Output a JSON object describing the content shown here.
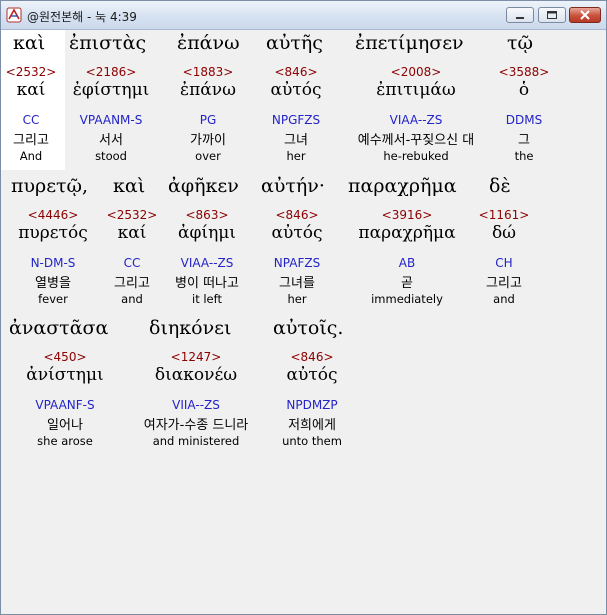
{
  "window": {
    "title": "@원전본해 - 눅 4:39",
    "icons": {
      "app": "app-logo-icon",
      "minimize": "minimize-icon",
      "maximize": "maximize-icon",
      "close": "close-icon"
    }
  },
  "words": [
    {
      "greek": "καὶ",
      "strong": "<2532>",
      "lemma": "καί",
      "parse": "CC",
      "korean": "그리고",
      "english": "And"
    },
    {
      "greek": "ἐπιστὰς",
      "strong": "<2186>",
      "lemma": "ἐφίστημι",
      "parse": "VPAANM-S",
      "korean": "서서",
      "english": "stood"
    },
    {
      "greek": "ἐπάνω",
      "strong": "<1883>",
      "lemma": "ἐπάνω",
      "parse": "PG",
      "korean": "가까이",
      "english": "over"
    },
    {
      "greek": "αὐτῆς",
      "strong": "<846>",
      "lemma": "αὐτός",
      "parse": "NPGFZS",
      "korean": "그녀",
      "english": "her"
    },
    {
      "greek": "ἐπετίμησεν",
      "strong": "<2008>",
      "lemma": "ἐπιτιμάω",
      "parse": "VIAA--ZS",
      "korean": "예수께서-꾸짖으신 대",
      "english": "he-rebuked"
    },
    {
      "greek": "τῷ",
      "strong": "<3588>",
      "lemma": "ὁ",
      "parse": "DDMS",
      "korean": "그",
      "english": "the"
    },
    {
      "greek": "πυρετῷ,",
      "strong": "<4446>",
      "lemma": "πυρετός",
      "parse": "N-DM-S",
      "korean": "열병을",
      "english": "fever"
    },
    {
      "greek": "καὶ",
      "strong": "<2532>",
      "lemma": "καί",
      "parse": "CC",
      "korean": "그리고",
      "english": "and"
    },
    {
      "greek": "ἀφῆκεν",
      "strong": "<863>",
      "lemma": "ἀφίημι",
      "parse": "VIAA--ZS",
      "korean": "병이 떠나고",
      "english": "it left"
    },
    {
      "greek": "αὐτήν·",
      "strong": "<846>",
      "lemma": "αὐτός",
      "parse": "NPAFZS",
      "korean": "그녀를",
      "english": "her"
    },
    {
      "greek": "παραχρῆμα",
      "strong": "<3916>",
      "lemma": "παραχρῆμα",
      "parse": "AB",
      "korean": "곧",
      "english": "immediately"
    },
    {
      "greek": "δὲ",
      "strong": "<1161>",
      "lemma": "δώ",
      "parse": "CH",
      "korean": "그리고",
      "english": "and"
    },
    {
      "greek": "ἀναστᾶσα",
      "strong": "<450>",
      "lemma": "ἀνίστημι",
      "parse": "VPAANF-S",
      "korean": "일어나",
      "english": "she arose"
    },
    {
      "greek": "διηκόνει",
      "strong": "<1247>",
      "lemma": "διακονέω",
      "parse": "VIIA--ZS",
      "korean": "여자가-수종 드니라",
      "english": "and ministered"
    },
    {
      "greek": "αὐτοῖς.",
      "strong": "<846>",
      "lemma": "αὐτός",
      "parse": "NPDMZP",
      "korean": "저희에게",
      "english": "unto them"
    }
  ],
  "colors": {
    "strong": "#8b0000",
    "parse": "#2323c8",
    "background": "#f0f0f0",
    "highlight": "#ffffff"
  }
}
